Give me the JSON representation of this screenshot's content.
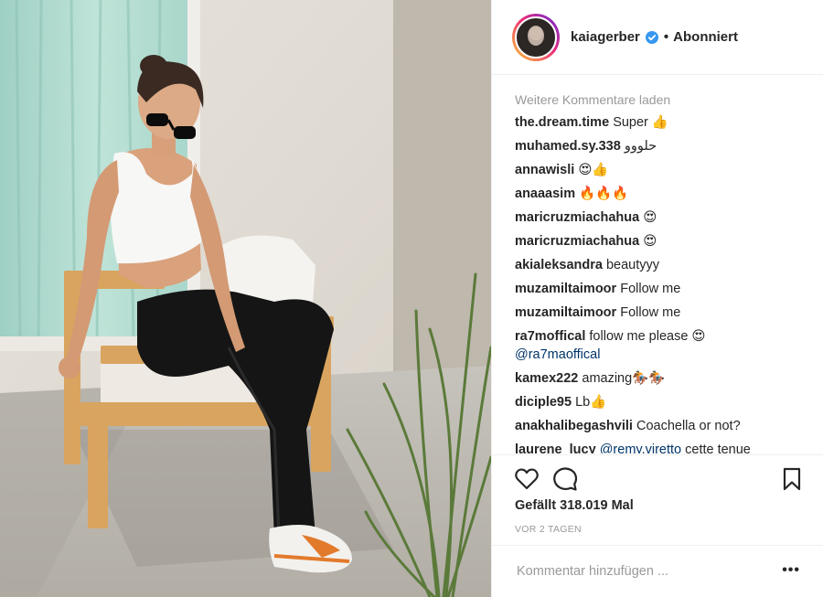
{
  "photo": {
    "description_icon": "photo"
  },
  "profile": {
    "username": "kaiagerber",
    "separator": "•",
    "follow_state": "Abonniert"
  },
  "comments": {
    "load_more": "Weitere Kommentare laden",
    "items": [
      {
        "user": "the.dream.time",
        "text": "Super 👍"
      },
      {
        "user": "muhamed.sy.338",
        "text": "حلووو"
      },
      {
        "user": "annawisli",
        "text": "😍👍"
      },
      {
        "user": "anaaasim",
        "text": "🔥🔥🔥"
      },
      {
        "user": "maricruzmiachahua",
        "text": "😍"
      },
      {
        "user": "maricruzmiachahua",
        "text": "😍"
      },
      {
        "user": "akialeksandra",
        "text": "beautyyy"
      },
      {
        "user": "muzamiltaimoor",
        "text": "Follow me"
      },
      {
        "user": "muzamiltaimoor",
        "text": "Follow me"
      },
      {
        "user": "ra7moffical",
        "text": "follow me please 😍",
        "mention": "@ra7maoffical"
      },
      {
        "user": "kamex222",
        "text": "amazing🏇🏇"
      },
      {
        "user": "diciple95",
        "text": "Lb👍"
      },
      {
        "user": "anakhalibegashvili",
        "text": "Coachella or not?"
      },
      {
        "user": "laurene_lucy",
        "mention": "@remy.viretto",
        "text": "cette tenue"
      }
    ]
  },
  "likes": "Gefällt 318.019 Mal",
  "time": "VOR 2 TAGEN",
  "add_comment_placeholder": "Kommentar hinzufügen ...",
  "more_label": "•••",
  "icons": {
    "like": "heart-icon",
    "comment": "comment-icon",
    "save": "bookmark-icon",
    "verified": "verified-badge-icon"
  },
  "colors": {
    "verified": "#3897f0",
    "link": "#003569",
    "muted": "#999999",
    "text": "#262626"
  }
}
